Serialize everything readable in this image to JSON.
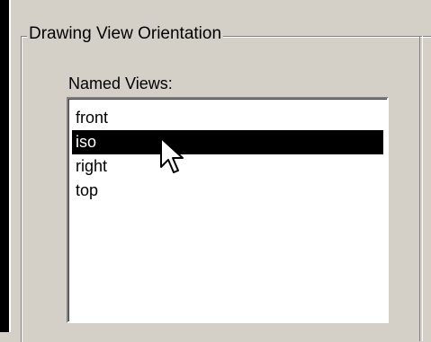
{
  "group": {
    "title": "Drawing View Orientation"
  },
  "named_views": {
    "label": "Named Views:",
    "items": [
      {
        "label": "front",
        "selected": false
      },
      {
        "label": "iso",
        "selected": true
      },
      {
        "label": "right",
        "selected": false
      },
      {
        "label": "top",
        "selected": false
      }
    ]
  },
  "icons": {
    "cursor": "mouse-pointer-icon"
  },
  "colors": {
    "dialog_background": "#d4d0c8",
    "selection_background": "#000000",
    "selection_text": "#ffffff"
  }
}
